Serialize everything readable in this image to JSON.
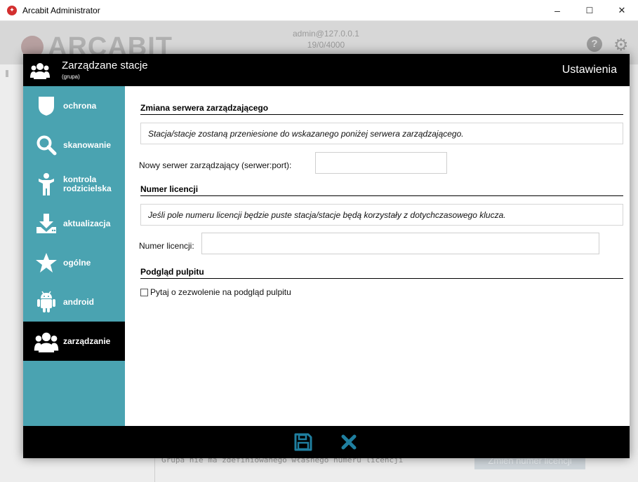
{
  "window": {
    "title": "Arcabit Administrator",
    "controls": {
      "minimize": "–",
      "maximize": "☐",
      "close": "✕"
    }
  },
  "background": {
    "logo": "ARCABIT",
    "user": "admin@127.0.0.1",
    "user_sub": "19/0/4000",
    "footer_text": "Grupa nie ma zdefiniowanego własnego numeru licencji",
    "footer_button": "Zmień numer licencji"
  },
  "modal": {
    "title": "Zarządzane stacje",
    "subtitle": "(grupa)",
    "header_right": "Ustawienia",
    "sidebar": [
      {
        "label": "ochrona",
        "icon": "shield-icon"
      },
      {
        "label": "skanowanie",
        "icon": "search-icon"
      },
      {
        "label": "kontrola rodzicielska",
        "icon": "parental-control-icon"
      },
      {
        "label": "aktualizacja",
        "icon": "download-icon"
      },
      {
        "label": "ogólne",
        "icon": "star-icon"
      },
      {
        "label": "android",
        "icon": "android-icon"
      },
      {
        "label": "zarządzanie",
        "icon": "users-icon",
        "active": true
      }
    ],
    "sections": {
      "server": {
        "title": "Zmiana serwera zarządzającego",
        "info": "Stacja/stacje zostaną przeniesione do wskazanego poniżej serwera zarządzającego.",
        "field_label": "Nowy serwer zarządzający (serwer:port):",
        "field_value": ""
      },
      "license": {
        "title": "Numer licencji",
        "info": "Jeśli pole numeru licencji będzie puste stacja/stacje będą korzystały z dotychczasowego klucza.",
        "field_label": "Numer licencji:",
        "field_value": ""
      },
      "preview": {
        "title": "Podgląd pulpitu",
        "checkbox_label": "Pytaj o zezwolenie na podgląd pulpitu",
        "checked": false
      }
    },
    "footer": {
      "save_icon": "save-icon",
      "cancel_icon": "close-icon"
    },
    "colors": {
      "sidebar": "#4aa3b1",
      "accent": "#1f7fa0",
      "header": "#000000"
    }
  }
}
